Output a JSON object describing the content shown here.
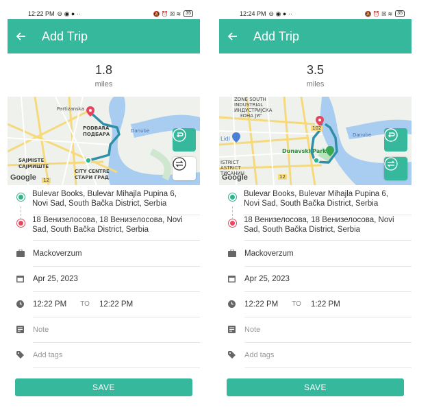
{
  "accent": "#35b89c",
  "start_dot_color": "#2ab58f",
  "end_dot_color": "#e8465f",
  "screens": [
    {
      "status_time": "12:22 PM",
      "status_battery": "35",
      "title": "Add Trip",
      "distance": "1.8",
      "distance_unit": "miles",
      "map_labels": [
        "Partizanska",
        "PODBARA",
        "ПОДБАРА",
        "Danube",
        "SAJMISTE",
        "САЈМИШТЕ",
        "CITY CENTRE",
        "СТАРИ ГРАД",
        "12"
      ],
      "google": "Google",
      "from": "Bulevar Books, Bulevar Mihajla Pupina 6, Novi Sad, South Bačka District, Serbia",
      "to_addr": "18 Венизелосова, 18 Венизелосова, Novi Sad, South Bačka District, Serbia",
      "vehicle": "Mackoverzum",
      "date": "Apr 25, 2023",
      "time_start": "12:22 PM",
      "to_word": "TO",
      "time_end": "12:22 PM",
      "note_placeholder": "Note",
      "tags_placeholder": "Add tags",
      "save": "SAVE"
    },
    {
      "status_time": "12:24 PM",
      "status_battery": "35",
      "title": "Add Trip",
      "distance": "3.5",
      "distance_unit": "miles",
      "map_labels": [
        "ZONE SOUTH",
        "INDUSTRIAL",
        "ИНДУСТРИЈСКА",
        "ЗОНА ЈУГ",
        "Lidl",
        "102",
        "Dunavski Park",
        "Danube",
        "ISTRICT",
        "ASTRICT",
        "ТИСАНИН",
        "12"
      ],
      "google": "Google",
      "from": "Bulevar Books, Bulevar Mihajla Pupina 6, Novi Sad, South Bačka District, Serbia",
      "to_addr": "18 Венизелосова, 18 Венизелосова, Novi Sad, South Bačka District, Serbia",
      "vehicle": "Mackoverzum",
      "date": "Apr 25, 2023",
      "time_start": "12:22 PM",
      "to_word": "TO",
      "time_end": "1:22 PM",
      "note_placeholder": "Note",
      "tags_placeholder": "Add tags",
      "save": "SAVE"
    }
  ]
}
